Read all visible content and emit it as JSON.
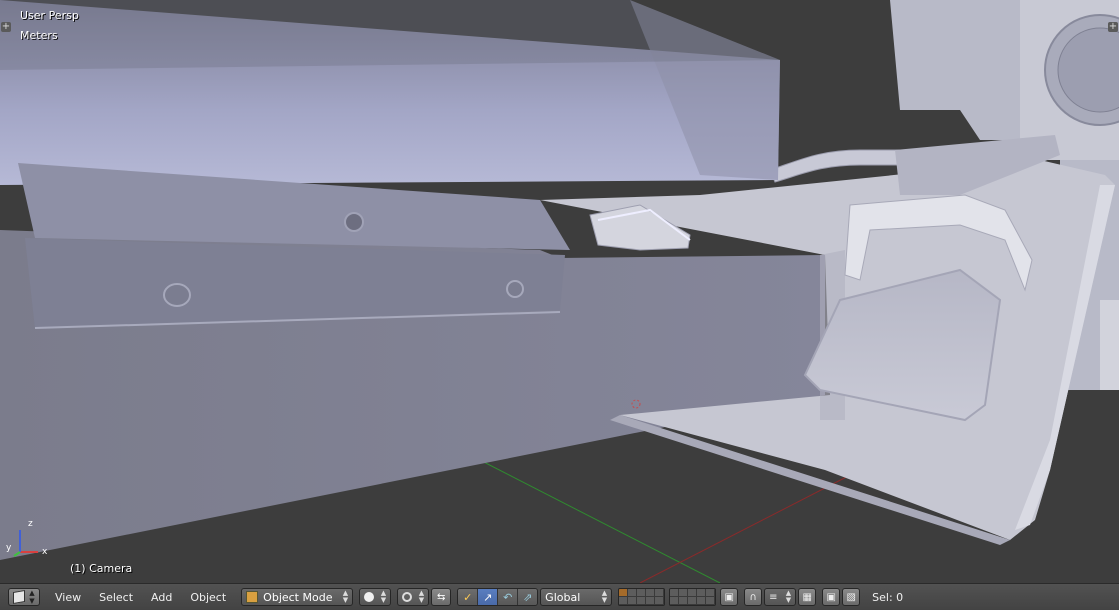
{
  "viewport": {
    "view_name": "User Persp",
    "units": "Meters",
    "active_object": "(1) Camera"
  },
  "header": {
    "editor_type_icon": "cube-icon",
    "menus": [
      "View",
      "Select",
      "Add",
      "Object"
    ],
    "mode": "Object Mode",
    "viewport_shading_icon": "solid-sphere-icon",
    "pivot_icon": "pivot-point-icon",
    "manipulator_icons": [
      "translate-axes-icon",
      "arrow-manipulator-icon",
      "rotate-manipulator-icon",
      "scale-manipulator-icon"
    ],
    "transform_orientation": "Global",
    "layers_icon": "layers-grid",
    "snap_icon": "magnet-icon",
    "proportional_icon": "proportional-edit-icon",
    "render_icons": [
      "camera-render-icon",
      "clapper-icon"
    ],
    "selection": "Sel: 0"
  },
  "colors": {
    "accent": "#5a7ec0",
    "background": "#3d3d3d",
    "header": "#4a4a4a",
    "mesh": "#8f90a8",
    "x_axis": "#8b2a2a",
    "y_axis": "#2a8b2a"
  }
}
